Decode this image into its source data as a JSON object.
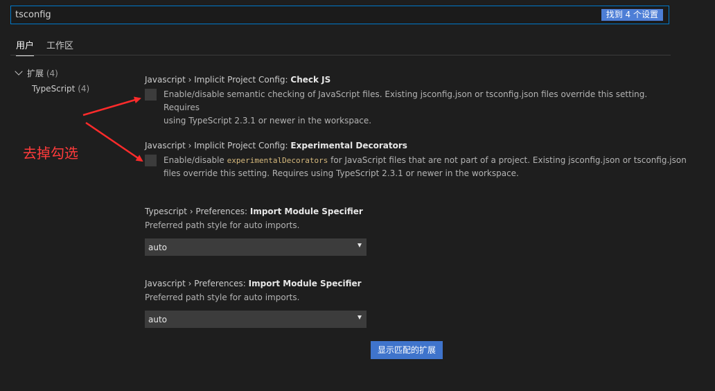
{
  "search": {
    "value": "tsconfig",
    "result_badge": "找到 4 个设置"
  },
  "tabs": [
    {
      "label": "用户",
      "active": true
    },
    {
      "label": "工作区",
      "active": false
    }
  ],
  "tree": {
    "group": {
      "label": "扩展",
      "count": "(4)"
    },
    "child": {
      "label": "TypeScript",
      "count": "(4)"
    }
  },
  "settings": [
    {
      "prefix": "Javascript › Implicit Project Config: ",
      "name": "Check JS",
      "type": "checkbox",
      "checked": false,
      "desc_line1": "Enable/disable semantic checking of JavaScript files. Existing jsconfig.json or tsconfig.json files override this setting. Requires",
      "desc_line2": "using TypeScript 2.3.1 or newer in the workspace."
    },
    {
      "prefix": "Javascript › Implicit Project Config: ",
      "name": "Experimental Decorators",
      "type": "checkbox",
      "checked": false,
      "desc_pre": "Enable/disable ",
      "desc_code": "experimentalDecorators",
      "desc_post": " for JavaScript files that are not part of a project. Existing jsconfig.json or tsconfig.json",
      "desc_line2": "files override this setting. Requires using TypeScript 2.3.1 or newer in the workspace."
    },
    {
      "prefix": "Typescript › Preferences: ",
      "name": "Import Module Specifier",
      "type": "select",
      "desc": "Preferred path style for auto imports.",
      "value": "auto"
    },
    {
      "prefix": "Javascript › Preferences: ",
      "name": "Import Module Specifier",
      "type": "select",
      "desc": "Preferred path style for auto imports.",
      "value": "auto"
    }
  ],
  "show_extensions_button": "显示匹配的扩展",
  "annotation": {
    "text": "去掉勾选",
    "color": "#ff3b3b"
  },
  "colors": {
    "accent": "#007acc",
    "button": "#3f74cc",
    "background": "#1e1e1e"
  }
}
